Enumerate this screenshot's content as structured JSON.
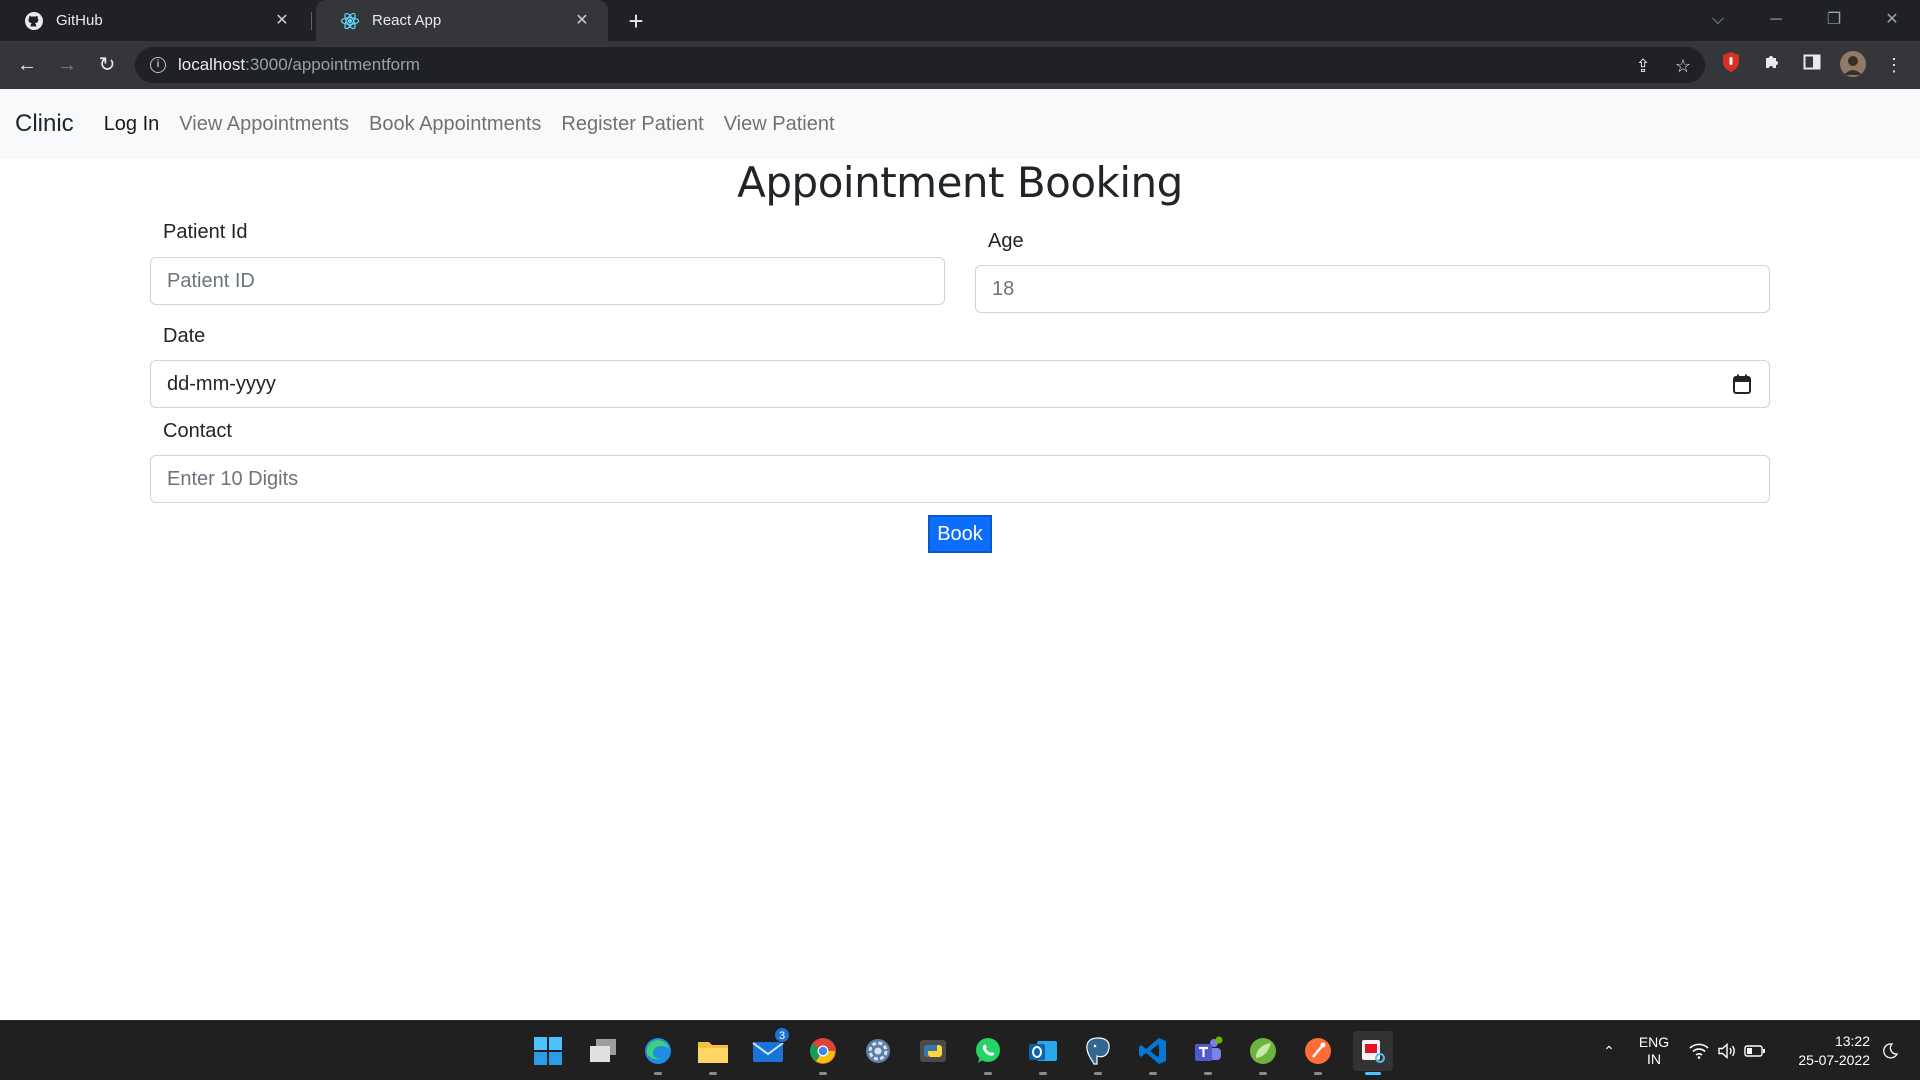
{
  "browser": {
    "tabs": [
      {
        "title": "GitHub",
        "icon": "github-icon",
        "active": false
      },
      {
        "title": "React App",
        "icon": "react-icon",
        "active": true
      }
    ],
    "url_host": "localhost",
    "url_path": ":3000/appointmentform"
  },
  "navbar": {
    "brand": "Clinic",
    "links": [
      "Log In",
      "View Appointments",
      "Book Appointments",
      "Register Patient",
      "View Patient"
    ]
  },
  "form": {
    "title": "Appointment Booking",
    "patient_id": {
      "label": "Patient Id",
      "placeholder": "Patient ID"
    },
    "age": {
      "label": "Age",
      "value": "18"
    },
    "date": {
      "label": "Date",
      "placeholder": "dd-mm-yyyy"
    },
    "contact": {
      "label": "Contact",
      "placeholder": "Enter 10 Digits"
    },
    "submit_label": "Book"
  },
  "taskbar": {
    "mail_badge": "3",
    "language": "ENG",
    "region": "IN",
    "time": "13:22",
    "date": "25-07-2022"
  },
  "colors": {
    "primary": "#0d6efd",
    "navbar_bg": "#f8f9fa",
    "chrome_dark": "#202124",
    "chrome_toolbar": "#35363a"
  }
}
